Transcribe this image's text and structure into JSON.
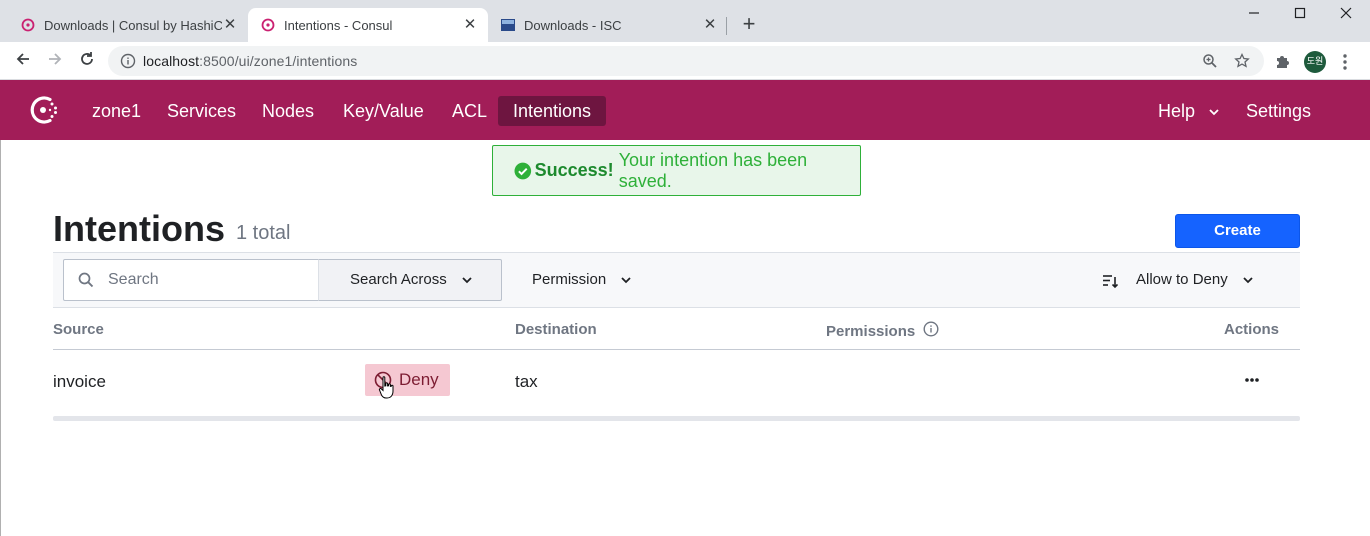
{
  "browser": {
    "tabs": [
      {
        "title": "Downloads | Consul by HashiCo",
        "active": false
      },
      {
        "title": "Intentions - Consul",
        "active": true
      },
      {
        "title": "Downloads - ISC",
        "active": false
      }
    ],
    "close_glyph": "✕",
    "new_tab_glyph": "+",
    "url_host": "localhost",
    "url_path": ":8500/ui/zone1/intentions",
    "profile_initials": "도원",
    "window_controls": {
      "minimize": "–",
      "maximize": "☐",
      "close": "✕"
    }
  },
  "nav": {
    "datacenter": "zone1",
    "items": [
      "Services",
      "Nodes",
      "Key/Value",
      "ACL",
      "Intentions"
    ],
    "current": "Intentions",
    "help": "Help",
    "settings": "Settings",
    "brand_color": "#a21d58"
  },
  "notification": {
    "title": "Success!",
    "message": "Your intention has been saved."
  },
  "page": {
    "title": "Intentions",
    "count": "1 total",
    "create_label": "Create"
  },
  "filters": {
    "search_placeholder": "Search",
    "search_across": "Search Across",
    "permission": "Permission",
    "sort": "Allow to Deny"
  },
  "table": {
    "columns": {
      "source": "Source",
      "destination": "Destination",
      "permissions": "Permissions",
      "actions": "Actions"
    },
    "rows": [
      {
        "source": "invoice",
        "action": "Deny",
        "destination": "tax",
        "permissions": "",
        "actions_icon": "more-horizontal-icon"
      }
    ]
  }
}
